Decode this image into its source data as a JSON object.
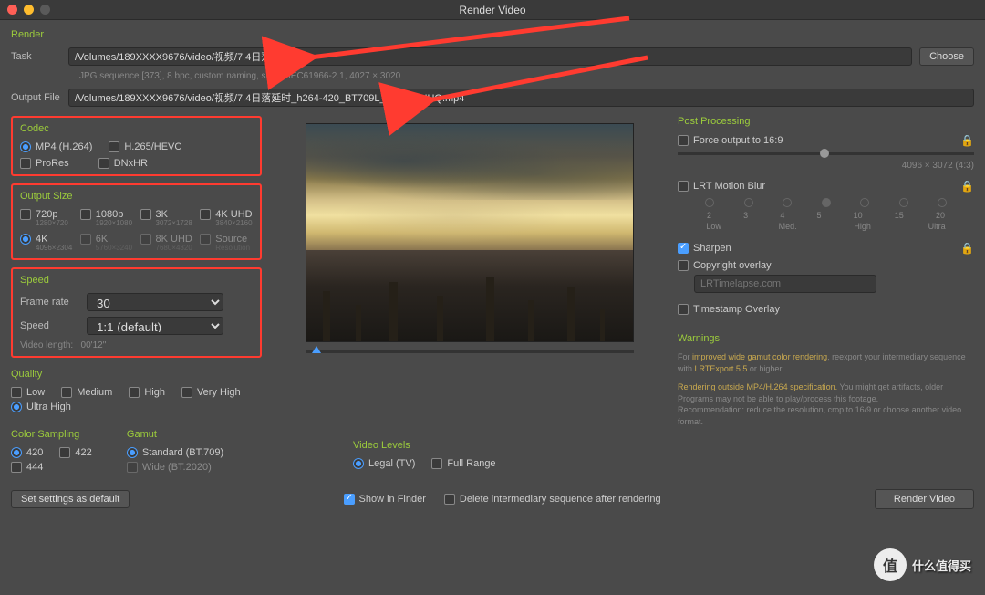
{
  "window": {
    "title": "Render Video"
  },
  "render": {
    "heading": "Render",
    "task_label": "Task",
    "task_value": "/Volumes/189XXXX9676/video/视频/7.4日落延时",
    "task_sub": "JPG sequence [373], 8 bpc, custom naming, sRGB IEC61966-2.1, 4027 × 3020",
    "output_label": "Output File",
    "output_value": "/Volumes/189XXXX9676/video/视频/7.4日落延时_h264-420_BT709L_4K_30_UHQ.mp4",
    "choose_btn": "Choose"
  },
  "codec": {
    "heading": "Codec",
    "opts": {
      "mp4": "MP4 (H.264)",
      "hevc": "H.265/HEVC",
      "prores": "ProRes",
      "dnxhr": "DNxHR"
    }
  },
  "size": {
    "heading": "Output Size",
    "opts": [
      {
        "main": "720p",
        "sub": "1280×720"
      },
      {
        "main": "1080p",
        "sub": "1920×1080"
      },
      {
        "main": "3K",
        "sub": "3072×1728"
      },
      {
        "main": "4K UHD",
        "sub": "3840×2160"
      },
      {
        "main": "4K",
        "sub": "4096×2304"
      },
      {
        "main": "6K",
        "sub": "5760×3240"
      },
      {
        "main": "8K UHD",
        "sub": "7680×4320"
      },
      {
        "main": "Source",
        "sub": "Resolution"
      }
    ]
  },
  "speed": {
    "heading": "Speed",
    "fr_label": "Frame rate",
    "fr_value": "30",
    "sp_label": "Speed",
    "sp_value": "1:1 (default)",
    "len_label": "Video length:",
    "len_value": "00'12\""
  },
  "quality": {
    "heading": "Quality",
    "opts": {
      "low": "Low",
      "med": "Medium",
      "high": "High",
      "vhigh": "Very High",
      "uhigh": "Ultra High"
    }
  },
  "sampling": {
    "heading": "Color Sampling",
    "o420": "420",
    "o422": "422",
    "o444": "444"
  },
  "gamut": {
    "heading": "Gamut",
    "std": "Standard (BT.709)",
    "wide": "Wide (BT.2020)"
  },
  "levels": {
    "heading": "Video Levels",
    "legal": "Legal (TV)",
    "full": "Full Range"
  },
  "pp": {
    "heading": "Post Processing",
    "force169": "Force output to 16:9",
    "ratio": "4096 × 3072 (4:3)",
    "mb": "LRT Motion Blur",
    "mb_nums": [
      "2",
      "3",
      "4",
      "5",
      "10",
      "15",
      "20"
    ],
    "mb_lbls": [
      "Low",
      "Med.",
      "High",
      "Ultra"
    ],
    "sharpen": "Sharpen",
    "copyright": "Copyright overlay",
    "copyright_ph": "LRTimelapse.com",
    "timestamp": "Timestamp Overlay"
  },
  "warnings": {
    "heading": "Warnings",
    "w1a": "For ",
    "w1b": "improved wide gamut color rendering",
    "w1c": ", reexport your intermediary sequence with ",
    "w1d": "LRTExport 5.5",
    "w1e": " or higher.",
    "w2a": "Rendering outside MP4/H.264 specification.",
    "w2b": " You might get artifacts, older Programs may not be able to play/process this footage.",
    "w2c": "Recommendation: reduce the resolution, crop to 16/9 or choose another video format."
  },
  "bottom": {
    "defaults": "Set settings as default",
    "show_finder": "Show in Finder",
    "delete_inter": "Delete intermediary sequence after rendering",
    "render_btn": "Render Video"
  },
  "watermark": {
    "char": "值",
    "text": "什么值得买"
  }
}
